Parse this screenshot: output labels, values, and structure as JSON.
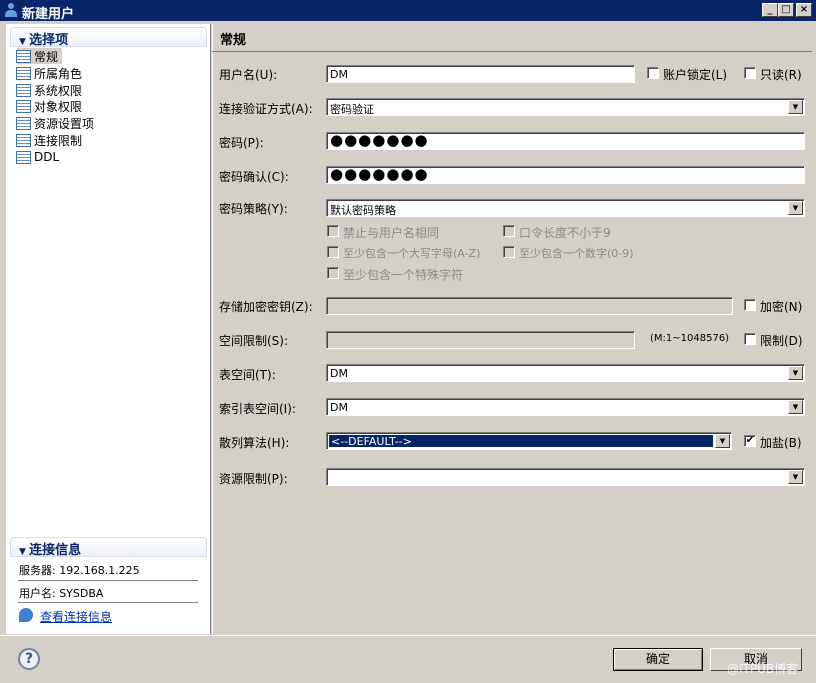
{
  "window": {
    "title": "新建用户",
    "minimize": "_",
    "maximize": "□",
    "close": "×"
  },
  "sidebar": {
    "section_title": "选择项",
    "items": [
      {
        "label": "常规"
      },
      {
        "label": "所属角色"
      },
      {
        "label": "系统权限"
      },
      {
        "label": "对象权限"
      },
      {
        "label": "资源设置项"
      },
      {
        "label": "连接限制"
      },
      {
        "label": "DDL"
      }
    ]
  },
  "connection": {
    "section_title": "连接信息",
    "server": "服务器: 192.168.1.225",
    "user": "用户名: SYSDBA",
    "link": "查看连接信息"
  },
  "main": {
    "title": "常规",
    "username": {
      "label": "用户名(U):",
      "value": "DM"
    },
    "account_lock": {
      "label": "账户锁定(L)",
      "checked": false
    },
    "readonly": {
      "label": "只读(R)",
      "checked": false
    },
    "auth": {
      "label": "连接验证方式(A):",
      "value": "密码验证"
    },
    "password": {
      "label": "密码(P):",
      "value": "●●●●●●●"
    },
    "password_confirm": {
      "label": "密码确认(C):",
      "value": "●●●●●●●"
    },
    "policy": {
      "label": "密码策略(Y):",
      "value": "默认密码策略"
    },
    "policy_options": [
      "禁止与用户名相同",
      "口令长度不小于9",
      "至少包含一个大写字母(A-Z)",
      "至少包含一个数字(0-9)",
      "至少包含一个特殊字符"
    ],
    "storage_key": {
      "label": "存储加密密钥(Z):",
      "value": ""
    },
    "encrypt": {
      "label": "加密(N)",
      "checked": false
    },
    "space_limit": {
      "label": "空间限制(S):",
      "value": "",
      "range": "(M:1~1048576)"
    },
    "limit": {
      "label": "限制(D)",
      "checked": false
    },
    "tablespace": {
      "label": "表空间(T):",
      "value": "DM"
    },
    "index_tablespace": {
      "label": "索引表空间(I):",
      "value": "DM"
    },
    "hash": {
      "label": "散列算法(H):",
      "value": "<--DEFAULT-->"
    },
    "salt": {
      "label": "加盐(B)",
      "checked": true
    },
    "resource_limit": {
      "label": "资源限制(P):",
      "value": ""
    }
  },
  "footer": {
    "help": "?",
    "ok": "确定",
    "cancel": "取消",
    "watermark": "@ITPUB博客"
  }
}
